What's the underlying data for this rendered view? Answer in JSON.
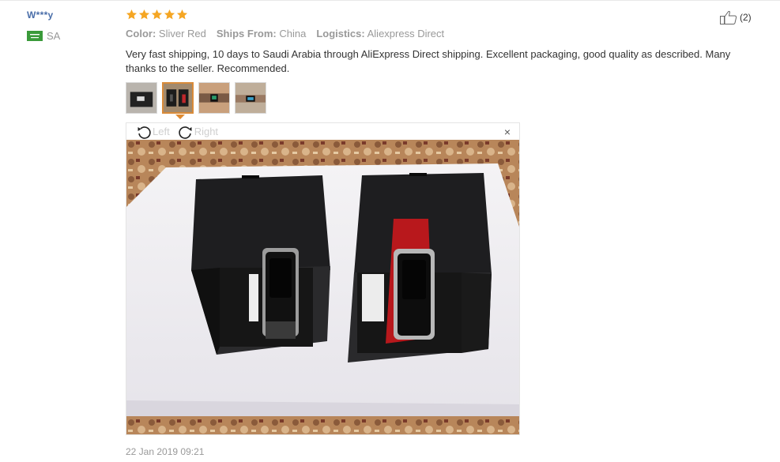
{
  "reviewer": {
    "name": "W***y",
    "country_code": "SA",
    "flag_icon": "saudi-flag-icon"
  },
  "rating": {
    "stars": 5,
    "max": 5,
    "color": "#f5a623"
  },
  "helpful": {
    "count": "(2)",
    "icon": "thumbs-up-icon"
  },
  "attributes": [
    {
      "label": "Color:",
      "value": "Sliver Red"
    },
    {
      "label": "Ships From:",
      "value": "China"
    },
    {
      "label": "Logistics:",
      "value": "Aliexpress Direct"
    }
  ],
  "review_text": "Very fast shipping, 10 days to Saudi Arabia through AliExpress Direct shipping. Excellent packaging, good quality as described. Many thanks to the seller. Recommended.",
  "photos": {
    "count": 4,
    "selected": 2
  },
  "viewer": {
    "rotate_left": "Left",
    "rotate_right": "Right",
    "close": "×"
  },
  "date": "22 Jan 2019 09:21",
  "colors": {
    "accent": "#e08a30",
    "name_link": "#4a6ea9",
    "muted": "#999999"
  }
}
